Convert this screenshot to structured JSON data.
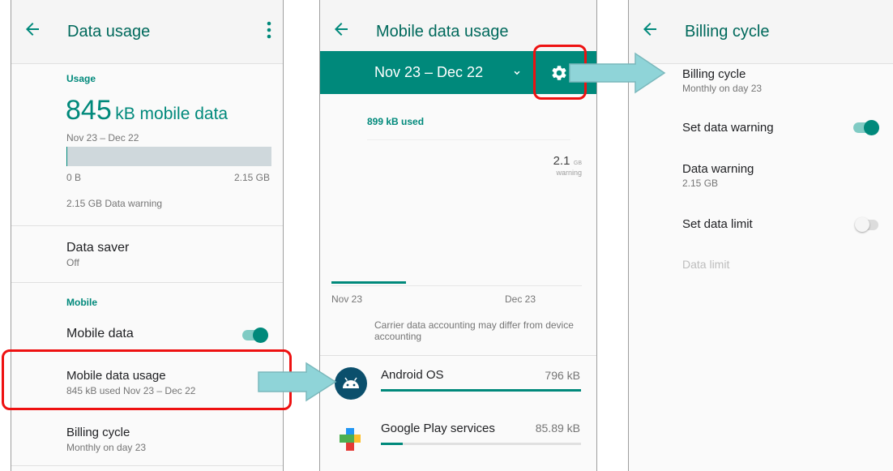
{
  "screen1": {
    "title": "Data usage",
    "usage_header": "Usage",
    "usage_amount": "845",
    "usage_unit": "kB mobile data",
    "period": "Nov 23 – Dec 22",
    "bar_min": "0 B",
    "bar_max": "2.15 GB",
    "bar_fraction": 0.0004,
    "warning_text": "2.15 GB Data warning",
    "data_saver": {
      "title": "Data saver",
      "value": "Off"
    },
    "mobile_header": "Mobile",
    "mobile_data": {
      "title": "Mobile data",
      "enabled": true
    },
    "mobile_data_usage": {
      "title": "Mobile data usage",
      "summary": "845 kB used Nov 23 – Dec 22"
    },
    "billing_cycle": {
      "title": "Billing cycle",
      "summary": "Monthly on day 23"
    }
  },
  "screen2": {
    "title": "Mobile data usage",
    "cycle_label": "Nov 23 – Dec 22",
    "used_label": "899 kB used",
    "warning_value": "2.1",
    "warning_unit": "GB",
    "warning_label": "warning",
    "axis_start": "Nov 23",
    "axis_end": "Dec 23",
    "note": "Carrier data accounting may differ from device accounting",
    "apps": [
      {
        "name": "Android OS",
        "usage": "796 kB",
        "fraction": 1.0
      },
      {
        "name": "Google Play services",
        "usage": "85.89 kB",
        "fraction": 0.11
      }
    ]
  },
  "screen3": {
    "title": "Billing cycle",
    "billing_cycle": {
      "title": "Billing cycle",
      "summary": "Monthly on day 23"
    },
    "set_data_warning": {
      "title": "Set data warning",
      "enabled": true
    },
    "data_warning": {
      "title": "Data warning",
      "value": "2.15 GB"
    },
    "set_data_limit": {
      "title": "Set data limit",
      "enabled": false
    },
    "data_limit": {
      "title": "Data limit"
    }
  },
  "colors": {
    "accent": "#00897b",
    "header_teal": "#00897b",
    "highlight_red": "#ee1111",
    "arrow_cyan": "#8fd4d8"
  }
}
